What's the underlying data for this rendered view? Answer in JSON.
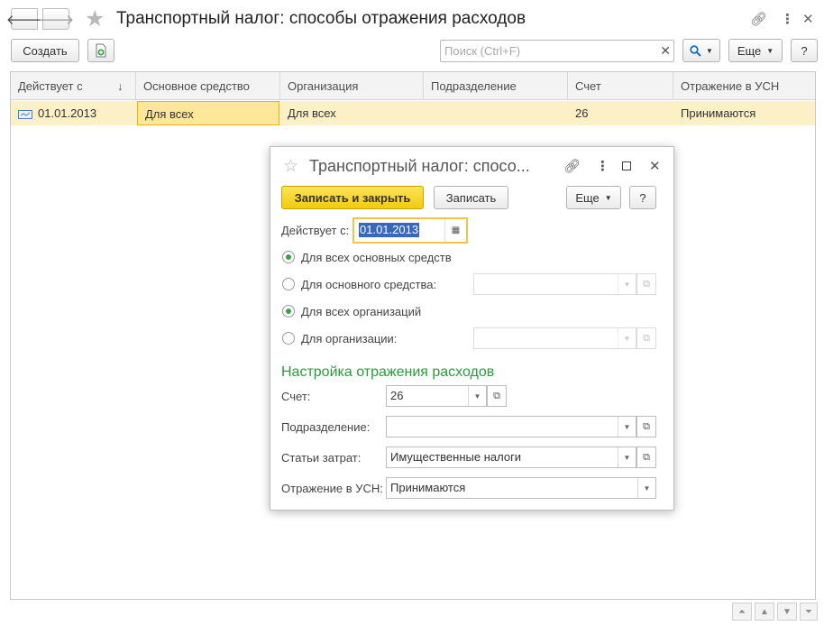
{
  "window": {
    "title": "Транспортный налог: способы отражения расходов",
    "nav_back_glyph": "🡐",
    "nav_forward_glyph": "🡒"
  },
  "toolbar": {
    "create_label": "Создать",
    "search_placeholder": "Поиск (Ctrl+F)",
    "more_label": "Еще",
    "help_label": "?"
  },
  "table": {
    "columns": [
      "Действует с",
      "Основное средство",
      "Организация",
      "Подразделение",
      "Счет",
      "Отражение в УСН"
    ],
    "sort_indicator": "↓",
    "rows": [
      {
        "date": "01.01.2013",
        "asset": "Для всех",
        "organization": "Для всех",
        "department": "",
        "account": "26",
        "usn": "Принимаются"
      }
    ]
  },
  "dialog": {
    "title": "Транспортный налог: спосо...",
    "save_close_label": "Записать и закрыть",
    "save_label": "Записать",
    "more_label": "Еще",
    "help_label": "?",
    "date_label": "Действует с:",
    "date_value": "01.01.2013",
    "radio_all_assets": "Для всех основных средств",
    "radio_one_asset": "Для основного средства:",
    "radio_all_orgs": "Для всех организаций",
    "radio_one_org": "Для организации:",
    "section_title": "Настройка отражения расходов",
    "account_label": "Счет:",
    "account_value": "26",
    "department_label": "Подразделение:",
    "department_value": "",
    "cost_items_label": "Статьи затрат:",
    "cost_items_value": "Имущественные налоги",
    "usn_label": "Отражение в УСН:",
    "usn_value": "Принимаются"
  },
  "colors": {
    "accent_yellow": "#f5d21a",
    "selected_row": "#fbf0c6",
    "section_green": "#2a9b3c"
  }
}
